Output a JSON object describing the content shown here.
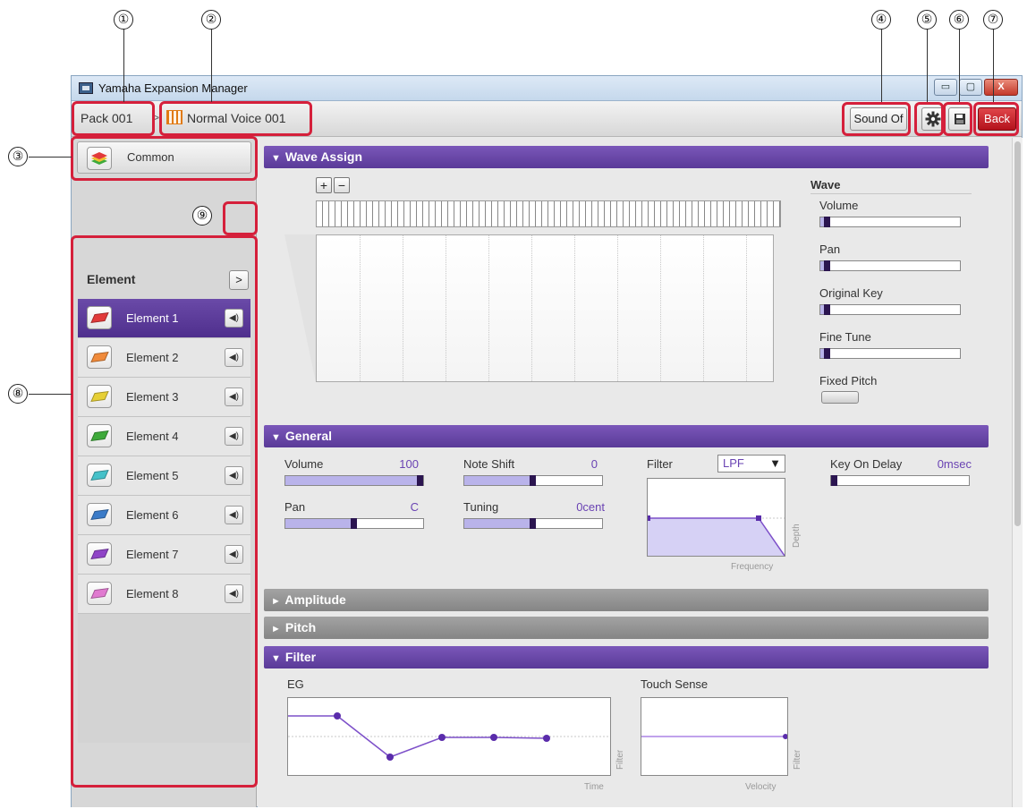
{
  "callouts": [
    "①",
    "②",
    "③",
    "④",
    "⑤",
    "⑥",
    "⑦",
    "⑧",
    "⑨"
  ],
  "window": {
    "title": "Yamaha Expansion Manager",
    "buttons": {
      "minimize": "▭",
      "maximize": "▢",
      "close": "X"
    }
  },
  "toolbar": {
    "breadcrumb_pack": "Pack 001",
    "breadcrumb_sep": ">",
    "breadcrumb_voice": "Normal Voice 001",
    "sound_off_label": "Sound Of",
    "settings_icon": "gear-icon",
    "save_icon": "floppy-icon",
    "back_label": "Back"
  },
  "sidebar": {
    "common_label": "Common",
    "element_heading": "Element",
    "toggle_label": ">",
    "speaker_glyph": "◀)",
    "elements": [
      {
        "label": "Element 1",
        "color": "#e23a3a",
        "selected": true
      },
      {
        "label": "Element 2",
        "color": "#f08a3a",
        "selected": false
      },
      {
        "label": "Element 3",
        "color": "#e6cf35",
        "selected": false
      },
      {
        "label": "Element 4",
        "color": "#3eaa3a",
        "selected": false
      },
      {
        "label": "Element 5",
        "color": "#45c1c9",
        "selected": false
      },
      {
        "label": "Element 6",
        "color": "#3a7bc8",
        "selected": false
      },
      {
        "label": "Element 7",
        "color": "#8f44c7",
        "selected": false
      },
      {
        "label": "Element 8",
        "color": "#e07ad0",
        "selected": false
      }
    ]
  },
  "wave_assign": {
    "title": "Wave Assign",
    "zoom_in": "+",
    "zoom_out": "−",
    "wave_heading": "Wave",
    "params": [
      {
        "label": "Volume",
        "level": 0.05
      },
      {
        "label": "Pan",
        "level": 0.05
      },
      {
        "label": "Original Key",
        "level": 0.05
      },
      {
        "label": "Fine Tune",
        "level": 0.05
      }
    ],
    "fixed_pitch_label": "Fixed Pitch"
  },
  "general": {
    "title": "General",
    "volume": {
      "label": "Volume",
      "value": "100",
      "level": 1.0
    },
    "pan": {
      "label": "Pan",
      "value": "C",
      "level": 0.5
    },
    "note_shift": {
      "label": "Note Shift",
      "value": "0",
      "level": 0.5
    },
    "tuning": {
      "label": "Tuning",
      "value": "0cent",
      "level": 0.5
    },
    "filter_label": "Filter",
    "filter_type": "LPF",
    "filter_dropdown": "▼",
    "filter_y_axis": "Depth",
    "filter_x_axis": "Frequency",
    "key_on_delay": {
      "label": "Key On Delay",
      "value": "0msec",
      "level": 0.0
    }
  },
  "collapsed_sections": [
    {
      "title": "Amplitude"
    },
    {
      "title": "Pitch"
    }
  ],
  "filter_section": {
    "title": "Filter",
    "eg_label": "EG",
    "eg_y_axis": "Filter",
    "eg_x_axis": "Time",
    "touch_label": "Touch Sense",
    "touch_y_axis": "Filter",
    "touch_x_axis": "Velocity"
  },
  "colors": {
    "accent_purple": "#5a3a98",
    "highlight_red": "#d5203b",
    "back_red": "#b3121b"
  }
}
